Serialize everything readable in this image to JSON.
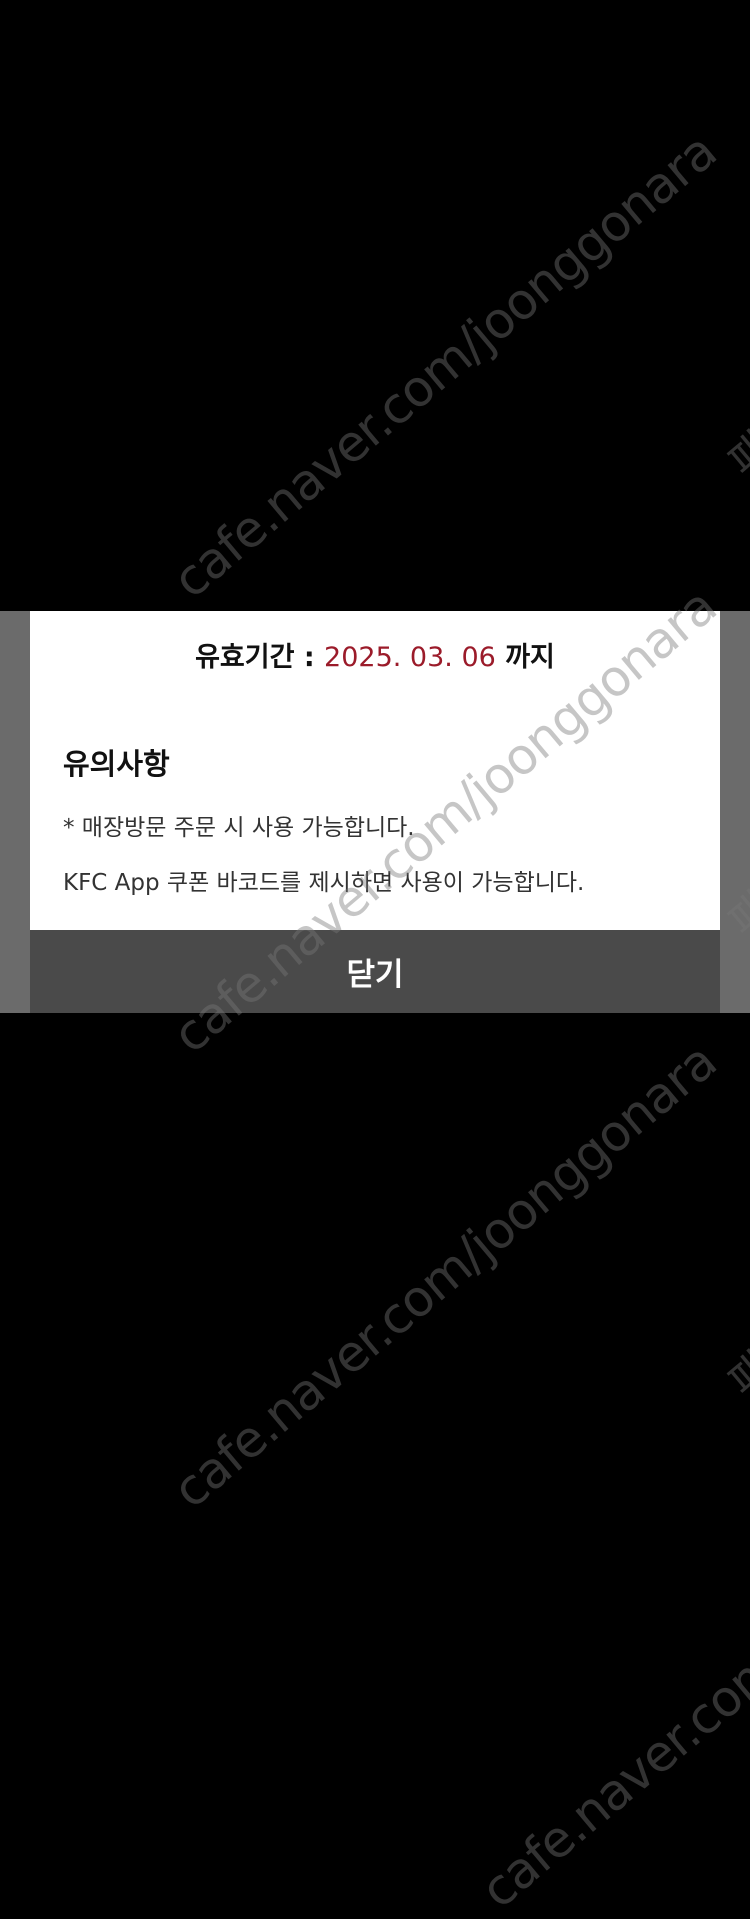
{
  "dialog": {
    "expiry_label": "유효기간 :",
    "expiry_date": "2025. 03. 06",
    "expiry_suffix": "까지",
    "notice_title": "유의사항",
    "notice_lines": [
      "* 매장방문 주문 시 사용 가능합니다.",
      "KFC App 쿠폰 바코드를 제시하면 사용이 가능합니다."
    ],
    "close_label": "닫기"
  },
  "watermark": {
    "text": "cafe.naver.com/joonggonara",
    "side_text": "패"
  },
  "colors": {
    "background": "#000000",
    "dialog": "#ffffff",
    "date_accent": "#9b1b2a",
    "close_button": "#4a4a4a",
    "side_bar": "#6b6b6b"
  }
}
